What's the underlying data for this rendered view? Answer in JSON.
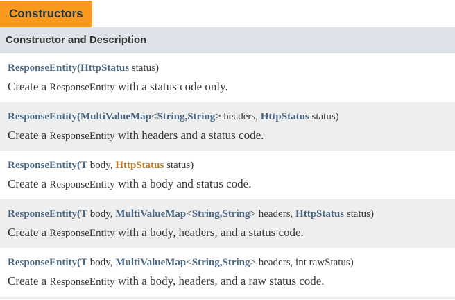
{
  "caption": "Constructors",
  "header": "Constructor and Description",
  "rows": [
    {
      "sig": [
        {
          "t": "ResponseEntity",
          "k": "link"
        },
        {
          "t": "(",
          "k": "link"
        },
        {
          "t": "HttpStatus",
          "k": "link"
        },
        {
          "t": " status)",
          "k": "plain"
        }
      ],
      "desc": [
        "Create a ",
        "ResponseEntity",
        " with a status code only."
      ]
    },
    {
      "sig": [
        {
          "t": "ResponseEntity",
          "k": "link"
        },
        {
          "t": "(",
          "k": "link"
        },
        {
          "t": "MultiValueMap",
          "k": "link"
        },
        {
          "t": "<",
          "k": "plain"
        },
        {
          "t": "String",
          "k": "link"
        },
        {
          "t": ",",
          "k": "link"
        },
        {
          "t": "String",
          "k": "link"
        },
        {
          "t": "> headers, ",
          "k": "plain"
        },
        {
          "t": "HttpStatus",
          "k": "link"
        },
        {
          "t": " status)",
          "k": "plain"
        }
      ],
      "desc": [
        "Create a ",
        "ResponseEntity",
        " with headers and a status code."
      ]
    },
    {
      "sig": [
        {
          "t": "ResponseEntity",
          "k": "link"
        },
        {
          "t": "(",
          "k": "link"
        },
        {
          "t": "T",
          "k": "link"
        },
        {
          "t": " body, ",
          "k": "plain"
        },
        {
          "t": "HttpStatus",
          "k": "hl"
        },
        {
          "t": " status)",
          "k": "plain"
        }
      ],
      "desc": [
        "Create a ",
        "ResponseEntity",
        " with a body and status code."
      ]
    },
    {
      "sig": [
        {
          "t": "ResponseEntity",
          "k": "link"
        },
        {
          "t": "(",
          "k": "link"
        },
        {
          "t": "T",
          "k": "link"
        },
        {
          "t": " body, ",
          "k": "plain"
        },
        {
          "t": "MultiValueMap",
          "k": "link"
        },
        {
          "t": "<",
          "k": "plain"
        },
        {
          "t": "String",
          "k": "link"
        },
        {
          "t": ",",
          "k": "link"
        },
        {
          "t": "String",
          "k": "link"
        },
        {
          "t": "> headers, ",
          "k": "plain"
        },
        {
          "t": "HttpStatus",
          "k": "link"
        },
        {
          "t": " status)",
          "k": "plain"
        }
      ],
      "desc": [
        "Create a ",
        "ResponseEntity",
        " with a body, headers, and a status code."
      ]
    },
    {
      "sig": [
        {
          "t": "ResponseEntity",
          "k": "link"
        },
        {
          "t": "(",
          "k": "link"
        },
        {
          "t": "T",
          "k": "link"
        },
        {
          "t": " body, ",
          "k": "plain"
        },
        {
          "t": "MultiValueMap",
          "k": "link"
        },
        {
          "t": "<",
          "k": "plain"
        },
        {
          "t": "String",
          "k": "link"
        },
        {
          "t": ",",
          "k": "link"
        },
        {
          "t": "String",
          "k": "link"
        },
        {
          "t": "> headers, int rawStatus)",
          "k": "plain"
        }
      ],
      "desc": [
        "Create a ",
        "ResponseEntity",
        " with a body, headers, and a raw status code."
      ]
    }
  ],
  "colors": {
    "caption_bg": "#f8981d",
    "header_bg": "#dee3e9",
    "alt_row_bg": "#eeeeef",
    "link": "#4a6782",
    "hovered_link": "#bb7a2a",
    "text": "#353833"
  }
}
